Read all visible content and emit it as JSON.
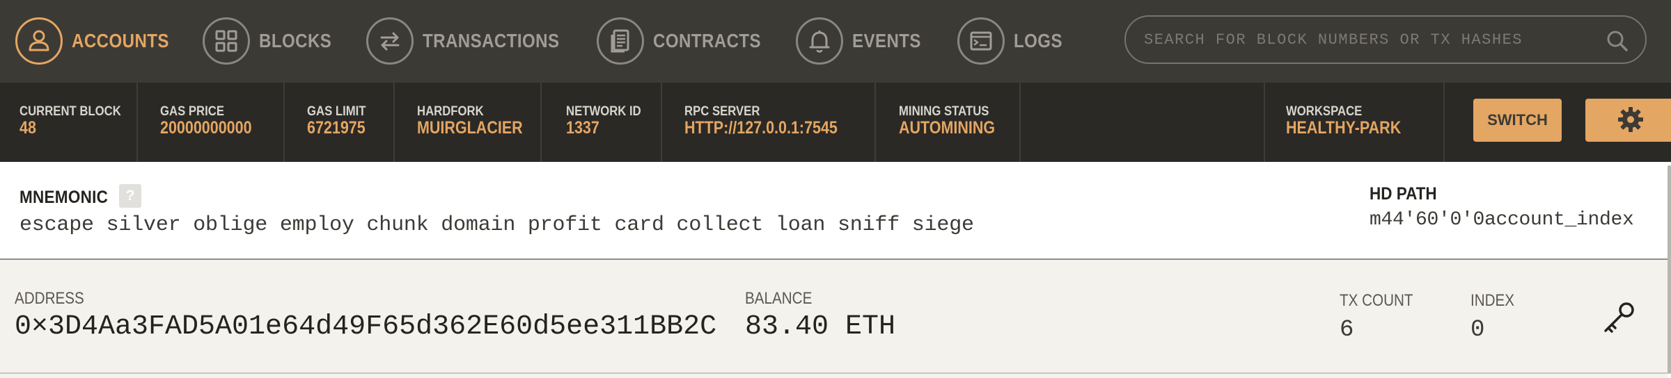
{
  "nav": {
    "items": [
      {
        "label": "ACCOUNTS",
        "icon": "account-icon",
        "active": true
      },
      {
        "label": "BLOCKS",
        "icon": "blocks-icon",
        "active": false
      },
      {
        "label": "TRANSACTIONS",
        "icon": "transactions-icon",
        "active": false
      },
      {
        "label": "CONTRACTS",
        "icon": "contracts-icon",
        "active": false
      },
      {
        "label": "EVENTS",
        "icon": "bell-icon",
        "active": false
      },
      {
        "label": "LOGS",
        "icon": "logs-icon",
        "active": false
      }
    ],
    "search": {
      "placeholder": "SEARCH FOR BLOCK NUMBERS OR TX HASHES",
      "value": "",
      "icon": "search-icon"
    }
  },
  "status": {
    "current_block": {
      "label": "CURRENT BLOCK",
      "value": "48"
    },
    "gas_price": {
      "label": "GAS PRICE",
      "value": "20000000000"
    },
    "gas_limit": {
      "label": "GAS LIMIT",
      "value": "6721975"
    },
    "hardfork": {
      "label": "HARDFORK",
      "value": "MUIRGLACIER"
    },
    "network_id": {
      "label": "NETWORK ID",
      "value": "1337"
    },
    "rpc_server": {
      "label": "RPC SERVER",
      "value": "HTTP://127.0.0.1:7545"
    },
    "mining_status": {
      "label": "MINING STATUS",
      "value": "AUTOMINING"
    },
    "workspace": {
      "label": "WORKSPACE",
      "value": "HEALTHY-PARK"
    },
    "switch_label": "SWITCH",
    "settings_icon": "gear-icon"
  },
  "mnemonic": {
    "title": "MNEMONIC",
    "help": "?",
    "words": "escape silver oblige employ chunk domain profit card collect loan sniff siege",
    "hd_path_title": "HD PATH",
    "hd_path_value": "m44'60'0'0account_index"
  },
  "accounts": [
    {
      "address_label": "ADDRESS",
      "address": "0×3D4Aa3FAD5A01e64d49F65d362E60d5ee311BB2C",
      "balance_label": "BALANCE",
      "balance": "83.40 ETH",
      "tx_count_label": "TX COUNT",
      "tx_count": "6",
      "index_label": "INDEX",
      "index": "0",
      "key_icon": "key-icon"
    }
  ],
  "colors": {
    "accent": "#e4a663",
    "nav_bg": "#3c3a35",
    "status_bg": "#2b2926",
    "muted": "#a09d95"
  }
}
